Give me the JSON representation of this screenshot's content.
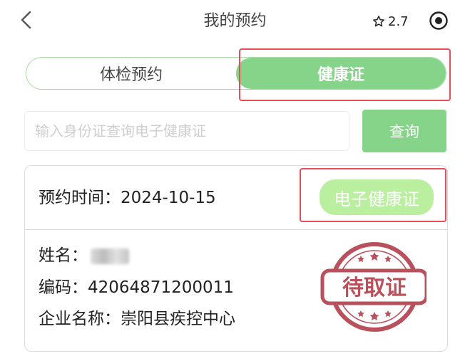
{
  "header": {
    "back_icon": "chevron-left-icon",
    "title": "我的预约",
    "rating": "2.7",
    "rating_icon": "star-outline-icon",
    "menu_icon": "target-icon"
  },
  "tabs": [
    {
      "label": "体检预约",
      "active": false
    },
    {
      "label": "健康证",
      "active": true
    }
  ],
  "search": {
    "placeholder": "输入身份证查询电子健康证",
    "value": "",
    "button_label": "查询"
  },
  "record": {
    "time_label": "预约时间：",
    "time_value": "2024-10-15",
    "ecert_button": "电子健康证",
    "name_label": "姓名：",
    "code_label": "编码：",
    "code_value": "42064871200011",
    "org_label": "企业名称：",
    "org_value": "崇阳县疾控中心",
    "stamp_text": "待取证"
  },
  "colors": {
    "accent_green": "#86d48a",
    "light_green": "#b9ef9e",
    "stamp_red": "#b3434f",
    "highlight_red": "#e94d5b"
  }
}
